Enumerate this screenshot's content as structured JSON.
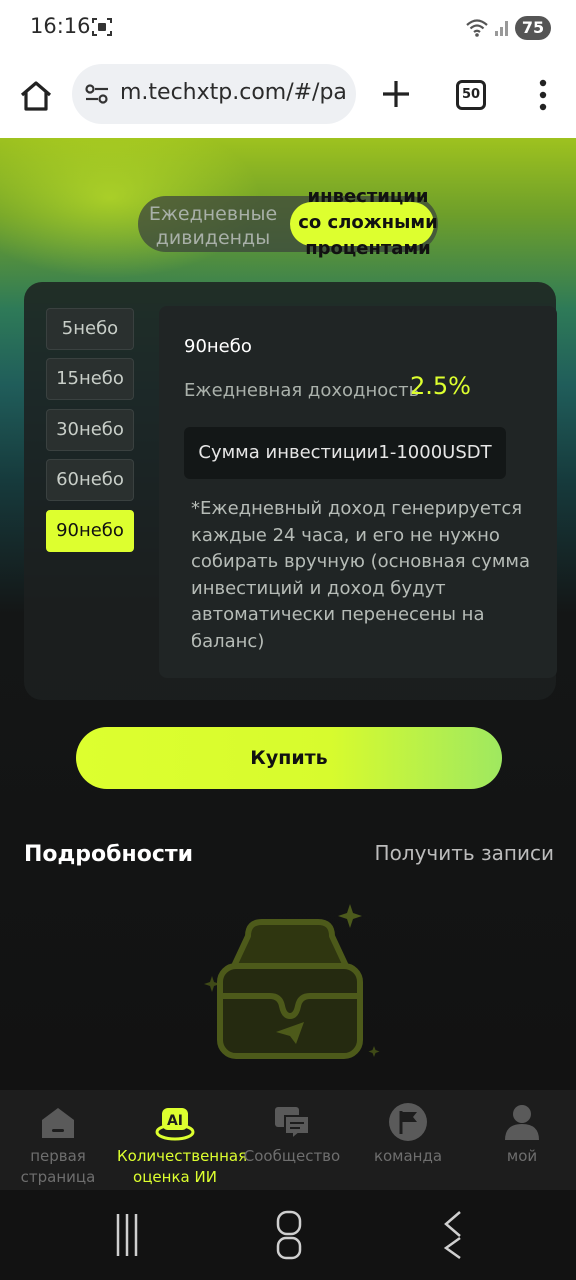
{
  "status_bar": {
    "time": "16:16",
    "battery": "75"
  },
  "browser": {
    "url": "m.techxtp.com/#/pa",
    "tab_count": "50"
  },
  "mode_toggle": {
    "left_label_line1": "Ежедневные",
    "left_label_line2": "дивиденды",
    "right_label_line1": "инвестиции",
    "right_label_line2": "со сложными",
    "right_label_line3": "процентами",
    "active": "right"
  },
  "tiers": [
    {
      "label": "5небо",
      "active": false
    },
    {
      "label": "15небо",
      "active": false
    },
    {
      "label": "30небо",
      "active": false
    },
    {
      "label": "60небо",
      "active": false
    },
    {
      "label": "90небо",
      "active": true
    }
  ],
  "plan": {
    "name": "90небо",
    "yield_label": "Ежедневная доходность",
    "yield_value": "2.5%",
    "amount": "Сумма инвестиции1-1000USDT",
    "note": "*Ежедневный доход генерируется каждые 24 часа, и его не нужно собирать вручную (основная сумма инвестиций и доход будут автоматически перенесены на баланс)"
  },
  "buy_label": "Купить",
  "details": {
    "title": "Подробности",
    "records_link": "Получить записи"
  },
  "bottom_nav": [
    {
      "label": "первая страница",
      "icon": "home-icon",
      "active": false
    },
    {
      "label": "Количественная оценка ИИ",
      "icon": "ai-icon",
      "ai_text": "AI",
      "active": true
    },
    {
      "label": "Сообщество",
      "icon": "chat-icon",
      "active": false
    },
    {
      "label": "команда",
      "icon": "flag-icon",
      "active": false
    },
    {
      "label": "мой",
      "icon": "user-icon",
      "active": false
    }
  ],
  "colors": {
    "accent": "#ddff2f",
    "background": "#121212",
    "nav_inactive": "#6e6e6e"
  }
}
